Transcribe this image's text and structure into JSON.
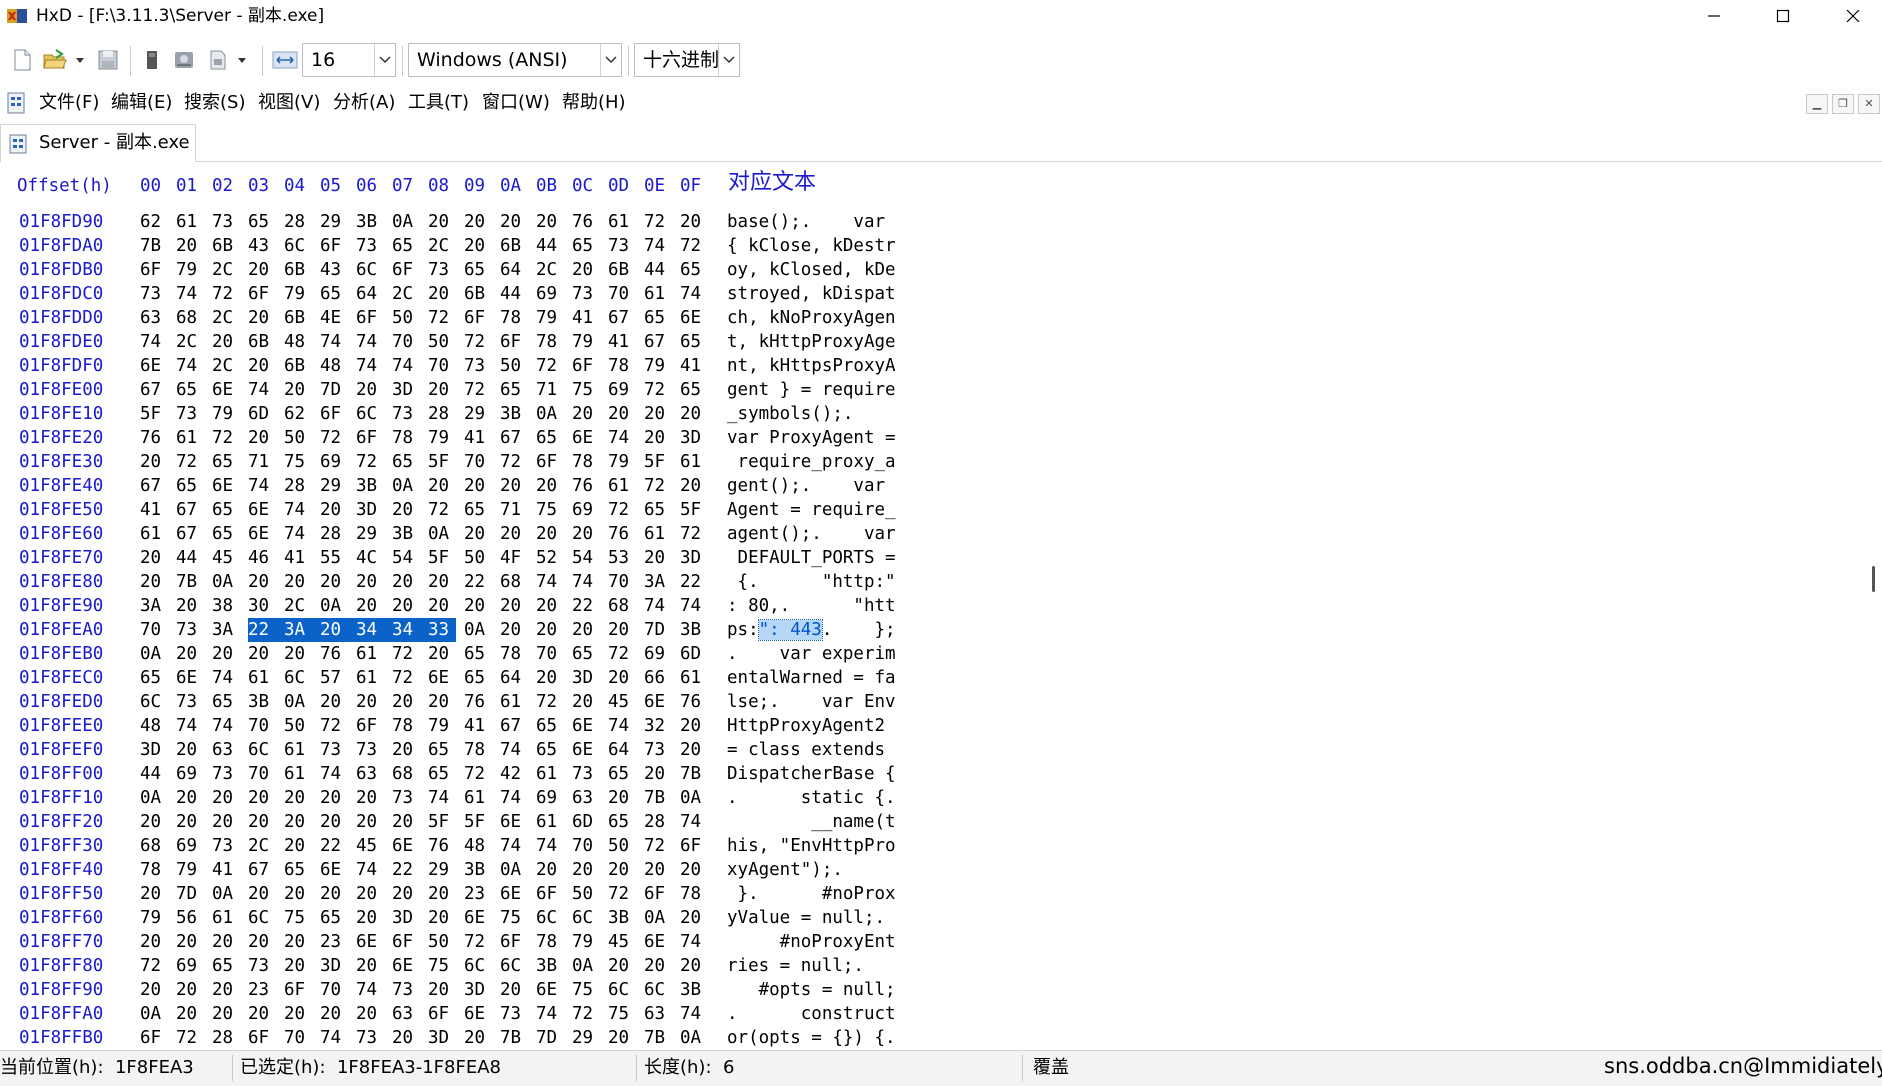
{
  "window": {
    "title": "HxD - [F:\\3.11.3\\Server - 副本.exe]"
  },
  "toolbar": {
    "bytes_per_row": "16",
    "charset": "Windows (ANSI)",
    "offset_base": "十六进制",
    "icons": [
      "new-file-icon",
      "open-file-icon",
      "dropdown-arrow-icon",
      "save-icon",
      "ram-icon",
      "disk-icon",
      "export-icon",
      "dropdown-arrow-icon",
      "bytes-per-row-icon"
    ]
  },
  "menu": {
    "items": [
      "文件(F)",
      "编辑(E)",
      "搜索(S)",
      "视图(V)",
      "分析(A)",
      "工具(T)",
      "窗口(W)",
      "帮助(H)"
    ]
  },
  "tab": {
    "label": "Server - 副本.exe"
  },
  "hex": {
    "header_offset": "Offset(h)",
    "columns": [
      "00",
      "01",
      "02",
      "03",
      "04",
      "05",
      "06",
      "07",
      "08",
      "09",
      "0A",
      "0B",
      "0C",
      "0D",
      "0E",
      "0F"
    ],
    "header_text": "对应文本",
    "rows": [
      {
        "offset": "01F8FD90",
        "bytes": [
          "62",
          "61",
          "73",
          "65",
          "28",
          "29",
          "3B",
          "0A",
          "20",
          "20",
          "20",
          "20",
          "76",
          "61",
          "72",
          "20"
        ],
        "text": "base();.    var "
      },
      {
        "offset": "01F8FDA0",
        "bytes": [
          "7B",
          "20",
          "6B",
          "43",
          "6C",
          "6F",
          "73",
          "65",
          "2C",
          "20",
          "6B",
          "44",
          "65",
          "73",
          "74",
          "72"
        ],
        "text": "{ kClose, kDestr"
      },
      {
        "offset": "01F8FDB0",
        "bytes": [
          "6F",
          "79",
          "2C",
          "20",
          "6B",
          "43",
          "6C",
          "6F",
          "73",
          "65",
          "64",
          "2C",
          "20",
          "6B",
          "44",
          "65"
        ],
        "text": "oy, kClosed, kDe"
      },
      {
        "offset": "01F8FDC0",
        "bytes": [
          "73",
          "74",
          "72",
          "6F",
          "79",
          "65",
          "64",
          "2C",
          "20",
          "6B",
          "44",
          "69",
          "73",
          "70",
          "61",
          "74"
        ],
        "text": "stroyed, kDispat"
      },
      {
        "offset": "01F8FDD0",
        "bytes": [
          "63",
          "68",
          "2C",
          "20",
          "6B",
          "4E",
          "6F",
          "50",
          "72",
          "6F",
          "78",
          "79",
          "41",
          "67",
          "65",
          "6E"
        ],
        "text": "ch, kNoProxyAgen"
      },
      {
        "offset": "01F8FDE0",
        "bytes": [
          "74",
          "2C",
          "20",
          "6B",
          "48",
          "74",
          "74",
          "70",
          "50",
          "72",
          "6F",
          "78",
          "79",
          "41",
          "67",
          "65"
        ],
        "text": "t, kHttpProxyAge"
      },
      {
        "offset": "01F8FDF0",
        "bytes": [
          "6E",
          "74",
          "2C",
          "20",
          "6B",
          "48",
          "74",
          "74",
          "70",
          "73",
          "50",
          "72",
          "6F",
          "78",
          "79",
          "41"
        ],
        "text": "nt, kHttpsProxyA"
      },
      {
        "offset": "01F8FE00",
        "bytes": [
          "67",
          "65",
          "6E",
          "74",
          "20",
          "7D",
          "20",
          "3D",
          "20",
          "72",
          "65",
          "71",
          "75",
          "69",
          "72",
          "65"
        ],
        "text": "gent } = require"
      },
      {
        "offset": "01F8FE10",
        "bytes": [
          "5F",
          "73",
          "79",
          "6D",
          "62",
          "6F",
          "6C",
          "73",
          "28",
          "29",
          "3B",
          "0A",
          "20",
          "20",
          "20",
          "20"
        ],
        "text": "_symbols();.    "
      },
      {
        "offset": "01F8FE20",
        "bytes": [
          "76",
          "61",
          "72",
          "20",
          "50",
          "72",
          "6F",
          "78",
          "79",
          "41",
          "67",
          "65",
          "6E",
          "74",
          "20",
          "3D"
        ],
        "text": "var ProxyAgent ="
      },
      {
        "offset": "01F8FE30",
        "bytes": [
          "20",
          "72",
          "65",
          "71",
          "75",
          "69",
          "72",
          "65",
          "5F",
          "70",
          "72",
          "6F",
          "78",
          "79",
          "5F",
          "61"
        ],
        "text": " require_proxy_a"
      },
      {
        "offset": "01F8FE40",
        "bytes": [
          "67",
          "65",
          "6E",
          "74",
          "28",
          "29",
          "3B",
          "0A",
          "20",
          "20",
          "20",
          "20",
          "76",
          "61",
          "72",
          "20"
        ],
        "text": "gent();.    var "
      },
      {
        "offset": "01F8FE50",
        "bytes": [
          "41",
          "67",
          "65",
          "6E",
          "74",
          "20",
          "3D",
          "20",
          "72",
          "65",
          "71",
          "75",
          "69",
          "72",
          "65",
          "5F"
        ],
        "text": "Agent = require_"
      },
      {
        "offset": "01F8FE60",
        "bytes": [
          "61",
          "67",
          "65",
          "6E",
          "74",
          "28",
          "29",
          "3B",
          "0A",
          "20",
          "20",
          "20",
          "20",
          "76",
          "61",
          "72"
        ],
        "text": "agent();.    var"
      },
      {
        "offset": "01F8FE70",
        "bytes": [
          "20",
          "44",
          "45",
          "46",
          "41",
          "55",
          "4C",
          "54",
          "5F",
          "50",
          "4F",
          "52",
          "54",
          "53",
          "20",
          "3D"
        ],
        "text": " DEFAULT_PORTS ="
      },
      {
        "offset": "01F8FE80",
        "bytes": [
          "20",
          "7B",
          "0A",
          "20",
          "20",
          "20",
          "20",
          "20",
          "20",
          "22",
          "68",
          "74",
          "74",
          "70",
          "3A",
          "22"
        ],
        "text": " {.      \"http:\""
      },
      {
        "offset": "01F8FE90",
        "bytes": [
          "3A",
          "20",
          "38",
          "30",
          "2C",
          "0A",
          "20",
          "20",
          "20",
          "20",
          "20",
          "20",
          "22",
          "68",
          "74",
          "74"
        ],
        "text": ": 80,.      \"htt"
      },
      {
        "offset": "01F8FEA0",
        "bytes": [
          "70",
          "73",
          "3A",
          "22",
          "3A",
          "20",
          "34",
          "34",
          "33",
          "0A",
          "20",
          "20",
          "20",
          "20",
          "7D",
          "3B"
        ],
        "text": "ps:\": 443.    };",
        "sel_from": 3,
        "sel_to": 8
      },
      {
        "offset": "01F8FEB0",
        "bytes": [
          "0A",
          "20",
          "20",
          "20",
          "20",
          "76",
          "61",
          "72",
          "20",
          "65",
          "78",
          "70",
          "65",
          "72",
          "69",
          "6D"
        ],
        "text": ".    var experim"
      },
      {
        "offset": "01F8FEC0",
        "bytes": [
          "65",
          "6E",
          "74",
          "61",
          "6C",
          "57",
          "61",
          "72",
          "6E",
          "65",
          "64",
          "20",
          "3D",
          "20",
          "66",
          "61"
        ],
        "text": "entalWarned = fa"
      },
      {
        "offset": "01F8FED0",
        "bytes": [
          "6C",
          "73",
          "65",
          "3B",
          "0A",
          "20",
          "20",
          "20",
          "20",
          "76",
          "61",
          "72",
          "20",
          "45",
          "6E",
          "76"
        ],
        "text": "lse;.    var Env"
      },
      {
        "offset": "01F8FEE0",
        "bytes": [
          "48",
          "74",
          "74",
          "70",
          "50",
          "72",
          "6F",
          "78",
          "79",
          "41",
          "67",
          "65",
          "6E",
          "74",
          "32",
          "20"
        ],
        "text": "HttpProxyAgent2 "
      },
      {
        "offset": "01F8FEF0",
        "bytes": [
          "3D",
          "20",
          "63",
          "6C",
          "61",
          "73",
          "73",
          "20",
          "65",
          "78",
          "74",
          "65",
          "6E",
          "64",
          "73",
          "20"
        ],
        "text": "= class extends "
      },
      {
        "offset": "01F8FF00",
        "bytes": [
          "44",
          "69",
          "73",
          "70",
          "61",
          "74",
          "63",
          "68",
          "65",
          "72",
          "42",
          "61",
          "73",
          "65",
          "20",
          "7B"
        ],
        "text": "DispatcherBase {"
      },
      {
        "offset": "01F8FF10",
        "bytes": [
          "0A",
          "20",
          "20",
          "20",
          "20",
          "20",
          "20",
          "73",
          "74",
          "61",
          "74",
          "69",
          "63",
          "20",
          "7B",
          "0A"
        ],
        "text": ".      static {."
      },
      {
        "offset": "01F8FF20",
        "bytes": [
          "20",
          "20",
          "20",
          "20",
          "20",
          "20",
          "20",
          "20",
          "5F",
          "5F",
          "6E",
          "61",
          "6D",
          "65",
          "28",
          "74"
        ],
        "text": "        __name(t"
      },
      {
        "offset": "01F8FF30",
        "bytes": [
          "68",
          "69",
          "73",
          "2C",
          "20",
          "22",
          "45",
          "6E",
          "76",
          "48",
          "74",
          "74",
          "70",
          "50",
          "72",
          "6F"
        ],
        "text": "his, \"EnvHttpPro"
      },
      {
        "offset": "01F8FF40",
        "bytes": [
          "78",
          "79",
          "41",
          "67",
          "65",
          "6E",
          "74",
          "22",
          "29",
          "3B",
          "0A",
          "20",
          "20",
          "20",
          "20",
          "20"
        ],
        "text": "xyAgent\");.     "
      },
      {
        "offset": "01F8FF50",
        "bytes": [
          "20",
          "7D",
          "0A",
          "20",
          "20",
          "20",
          "20",
          "20",
          "20",
          "23",
          "6E",
          "6F",
          "50",
          "72",
          "6F",
          "78"
        ],
        "text": " }.      #noProx"
      },
      {
        "offset": "01F8FF60",
        "bytes": [
          "79",
          "56",
          "61",
          "6C",
          "75",
          "65",
          "20",
          "3D",
          "20",
          "6E",
          "75",
          "6C",
          "6C",
          "3B",
          "0A",
          "20"
        ],
        "text": "yValue = null;. "
      },
      {
        "offset": "01F8FF70",
        "bytes": [
          "20",
          "20",
          "20",
          "20",
          "20",
          "23",
          "6E",
          "6F",
          "50",
          "72",
          "6F",
          "78",
          "79",
          "45",
          "6E",
          "74"
        ],
        "text": "     #noProxyEnt"
      },
      {
        "offset": "01F8FF80",
        "bytes": [
          "72",
          "69",
          "65",
          "73",
          "20",
          "3D",
          "20",
          "6E",
          "75",
          "6C",
          "6C",
          "3B",
          "0A",
          "20",
          "20",
          "20"
        ],
        "text": "ries = null;.   "
      },
      {
        "offset": "01F8FF90",
        "bytes": [
          "20",
          "20",
          "20",
          "23",
          "6F",
          "70",
          "74",
          "73",
          "20",
          "3D",
          "20",
          "6E",
          "75",
          "6C",
          "6C",
          "3B"
        ],
        "text": "   #opts = null;"
      },
      {
        "offset": "01F8FFA0",
        "bytes": [
          "0A",
          "20",
          "20",
          "20",
          "20",
          "20",
          "20",
          "63",
          "6F",
          "6E",
          "73",
          "74",
          "72",
          "75",
          "63",
          "74"
        ],
        "text": ".      construct"
      },
      {
        "offset": "01F8FFB0",
        "bytes": [
          "6F",
          "72",
          "28",
          "6F",
          "70",
          "74",
          "73",
          "20",
          "3D",
          "20",
          "7B",
          "7D",
          "29",
          "20",
          "7B",
          "0A"
        ],
        "text": "or(opts = {}) {."
      }
    ]
  },
  "status": {
    "position": "当前位置(h):  1F8FEA3",
    "selected": "已选定(h):  1F8FEA3-1F8FEA8",
    "length": "长度(h):  6",
    "mode": "覆盖",
    "watermark": "sns.oddba.cn@Immidiately"
  }
}
